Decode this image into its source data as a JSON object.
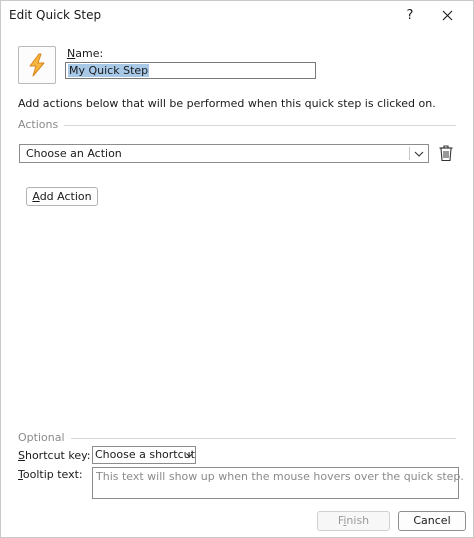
{
  "window": {
    "title": "Edit Quick Step",
    "help_glyph": "?",
    "close_glyph": "✕"
  },
  "name": {
    "label_mnemonic": "N",
    "label_rest": "ame:",
    "value": "My Quick Step"
  },
  "instructions": "Add actions below that will be performed when this quick step is clicked on.",
  "actions": {
    "group_label": "Actions",
    "select_value": "Choose an Action",
    "add_button_mnemonic": "A",
    "add_button_rest": "dd Action",
    "delete_icon": "trash-icon"
  },
  "optional": {
    "group_label": "Optional",
    "shortcut_label_mnemonic": "S",
    "shortcut_label_rest": "hortcut key:",
    "shortcut_value": "Choose a shortcut",
    "tooltip_label_mnemonic": "T",
    "tooltip_label_rest": "ooltip text:",
    "tooltip_placeholder": "This text will show up when the mouse hovers over the quick step."
  },
  "footer": {
    "finish_prefix": "F",
    "finish_mnemonic": "i",
    "finish_rest": "nish",
    "cancel_label": "Cancel"
  },
  "colors": {
    "icon_bolt_fill": "#f6b73c",
    "icon_bolt_stroke": "#d9831c",
    "selection_highlight": "#a8c8e8"
  }
}
